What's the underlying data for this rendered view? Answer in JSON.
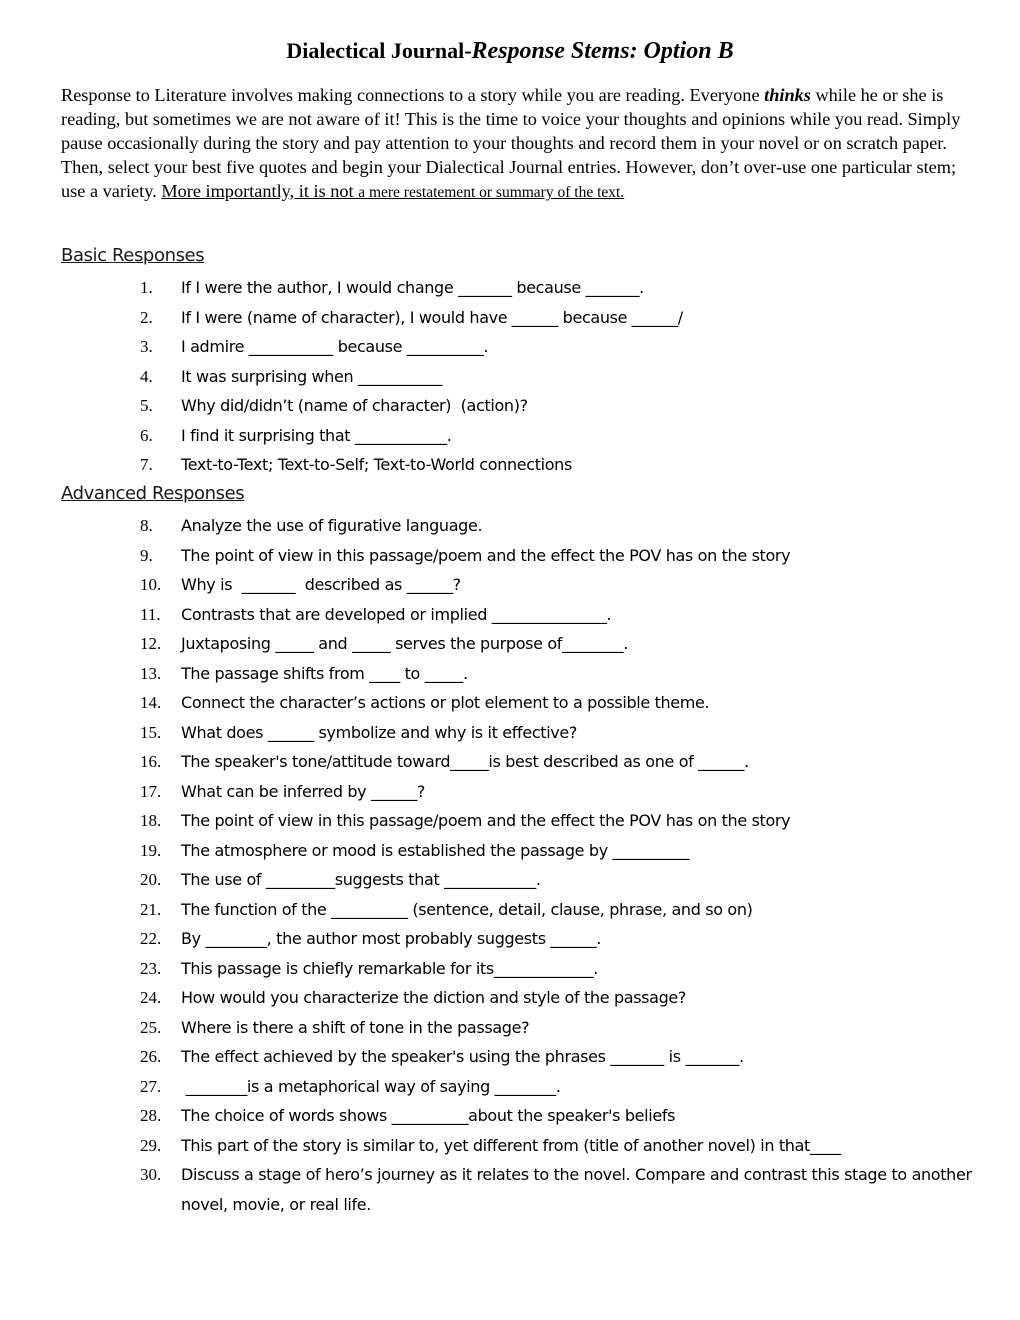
{
  "document": {
    "title_bold": "Dialectical Journal-",
    "title_italic": "Response Stems: Option B",
    "intro": {
      "part1": "Response to Literature involves making connections to a story while you are reading. Everyone ",
      "emphasis": "thinks",
      "part2": " while he or she is reading, but sometimes we are not aware of it! This is the time to voice your thoughts and opinions while you read. Simply pause occasionally during the story and pay attention to your thoughts and record them in your novel or on scratch paper. Then, select your best five quotes and begin your Dialectical Journal entries. However, don’t over-use one particular stem; use a variety. ",
      "underlined": "More importantly, it is not ",
      "underlined_small": "a mere restatement or summary of the text. "
    },
    "sections": [
      {
        "heading": "Basic Responses",
        "items": [
          {
            "num": "1.",
            "text": "If I were the author, I would change _______ because _______."
          },
          {
            "num": "2.",
            "text": "If I were (name of character), I would have ______ because ______/"
          },
          {
            "num": "3.",
            "text": "I admire ___________ because __________."
          },
          {
            "num": "4.",
            "text": "It was surprising when ___________"
          },
          {
            "num": "5.",
            "text": "Why did/didn’t (name of character)  (action)?"
          },
          {
            "num": "6.",
            "text": "I find it surprising that ____________."
          },
          {
            "num": "7.",
            "text": "Text-to-Text; Text-to-Self; Text-to-World connections"
          }
        ]
      },
      {
        "heading": "Advanced Responses",
        "items": [
          {
            "num": "8.",
            "text": "Analyze the use of figurative language."
          },
          {
            "num": "9.",
            "text": "The point of view in this passage/poem and the effect the POV has on the story"
          },
          {
            "num": "10.",
            "text": "Why is  _______  described as ______?"
          },
          {
            "num": "11.",
            "text": "Contrasts that are developed or implied _______________."
          },
          {
            "num": "12.",
            "text": "Juxtaposing _____ and _____ serves the purpose of________."
          },
          {
            "num": "13.",
            "text": "The passage shifts from ____ to _____."
          },
          {
            "num": "14.",
            "text": "Connect the character’s actions or plot element to a possible theme."
          },
          {
            "num": "15.",
            "text": "What does ______ symbolize and why is it effective?"
          },
          {
            "num": "16.",
            "text": "The speaker's tone/attitude toward_____is best described as one of ______."
          },
          {
            "num": "17.",
            "text": "What can be inferred by ______?"
          },
          {
            "num": "18.",
            "text": "The point of view in this passage/poem and the effect the POV has on the story"
          },
          {
            "num": "19.",
            "text": "The atmosphere or mood is established the passage by __________"
          },
          {
            "num": "20.",
            "text": "The use of _________suggests that ____________."
          },
          {
            "num": "21.",
            "text": "The function of the __________ (sentence, detail, clause, phrase, and so on)"
          },
          {
            "num": "22.",
            "text": "By ________, the author most probably suggests ______."
          },
          {
            "num": "23.",
            "text": "This passage is chiefly remarkable for its_____________."
          },
          {
            "num": "24.",
            "text": "How would you characterize the diction and style of the passage?"
          },
          {
            "num": "25.",
            "text": "Where is there a shift of tone in the passage?"
          },
          {
            "num": "26.",
            "text": "The effect achieved by the speaker's using the phrases _______ is _______."
          },
          {
            "num": "27.",
            "text": " ________is a metaphorical way of saying ________."
          },
          {
            "num": "28.",
            "text": "The choice of words shows __________about the speaker's beliefs"
          },
          {
            "num": "29.",
            "text": "This part of the story is similar to, yet different from (title of another novel) in that____"
          },
          {
            "num": "30.",
            "text": "Discuss a stage of hero’s journey as it relates to the novel. Compare and contrast this stage to another novel, movie, or real life."
          }
        ]
      }
    ]
  }
}
